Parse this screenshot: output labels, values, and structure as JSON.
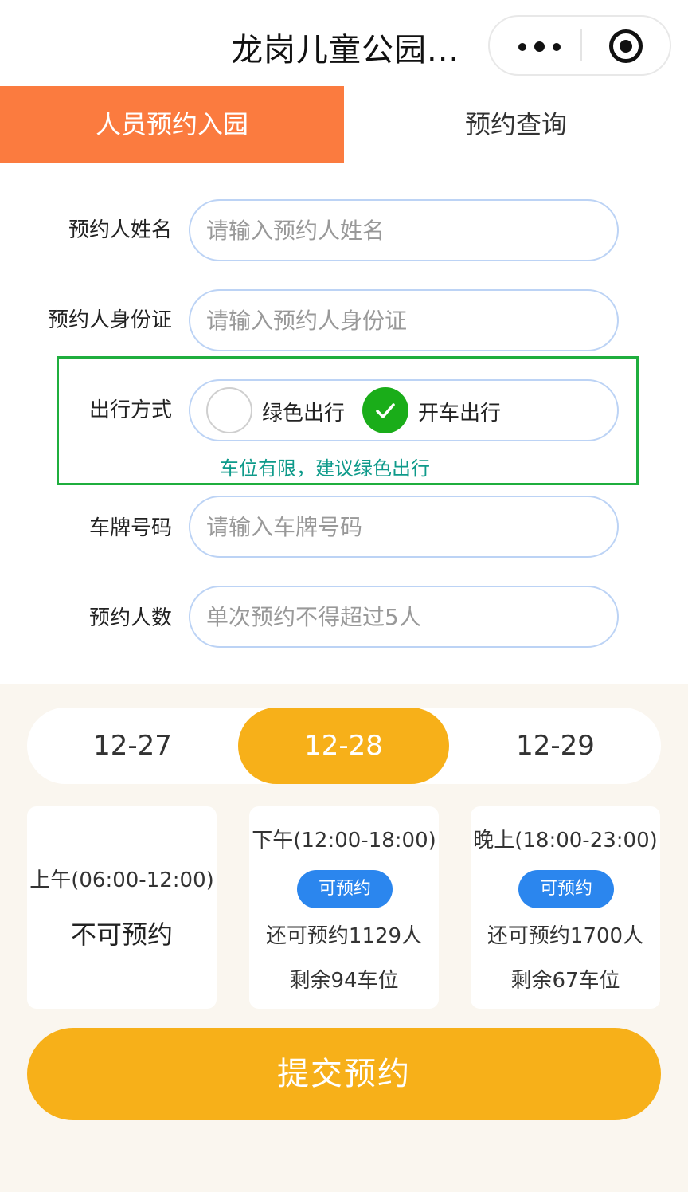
{
  "titlebar": {
    "title": "龙岗儿童公园..."
  },
  "tabs": [
    {
      "label": "人员预约入园"
    },
    {
      "label": "预约查询"
    }
  ],
  "form": {
    "name": {
      "label": "预约人姓名",
      "placeholder": "请输入预约人姓名"
    },
    "id_card": {
      "label": "预约人身份证",
      "placeholder": "请输入预约人身份证"
    },
    "travel": {
      "label": "出行方式",
      "options": [
        {
          "label": "绿色出行",
          "selected": false
        },
        {
          "label": "开车出行",
          "selected": true
        }
      ],
      "hint": "车位有限，建议绿色出行"
    },
    "plate": {
      "label": "车牌号码",
      "placeholder": "请输入车牌号码"
    },
    "count": {
      "label": "预约人数",
      "placeholder": "单次预约不得超过5人"
    }
  },
  "dates": [
    {
      "label": "12-27",
      "selected": false
    },
    {
      "label": "12-28",
      "selected": true
    },
    {
      "label": "12-29",
      "selected": false
    }
  ],
  "slots": [
    {
      "time": "上午(06:00-12:00)",
      "status": "不可预约"
    },
    {
      "time": "下午(12:00-18:00)",
      "badge": "可预约",
      "people": "还可预约1129人",
      "parking": "剩余94车位"
    },
    {
      "time": "晚上(18:00-23:00)",
      "badge": "可预约",
      "people": "还可预约1700人",
      "parking": "剩余67车位"
    }
  ],
  "submit": {
    "label": "提交预约"
  },
  "colors": {
    "tab_active": "#fb7b3f",
    "accent_yellow": "#f7b019",
    "badge_blue": "#2b86ee",
    "check_green": "#1aad19",
    "hint_teal": "#0e9a8a"
  }
}
